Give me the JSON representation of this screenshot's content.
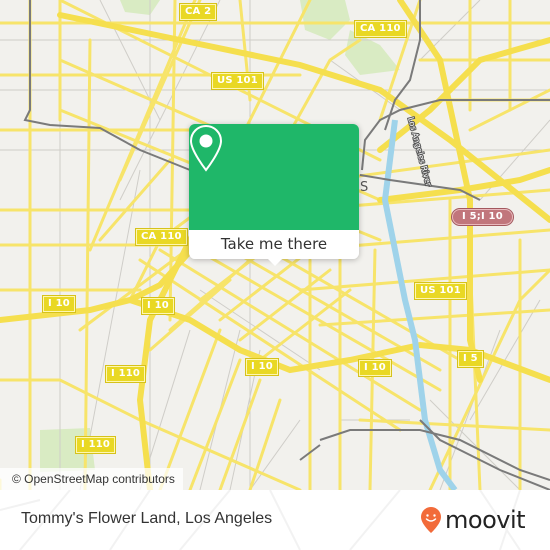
{
  "map": {
    "attribution": "© OpenStreetMap contributors",
    "colors": {
      "background": "#f2f1ed",
      "road": "#f7e46a",
      "road_edge": "#e2cc45",
      "water": "#9fd3ea",
      "rail": "#7a7a7a",
      "park": "#d9ebc3",
      "minor_road": "#c9c7c2"
    },
    "shields": [
      {
        "label": "CA 2",
        "type": "state"
      },
      {
        "label": "CA 110",
        "type": "state"
      },
      {
        "label": "US 101",
        "type": "us"
      },
      {
        "label": "I 5;I 10",
        "type": "interstate-combo"
      },
      {
        "label": "CA 110",
        "type": "state"
      },
      {
        "label": "I 10",
        "type": "interstate"
      },
      {
        "label": "I 10",
        "type": "interstate"
      },
      {
        "label": "US 101",
        "type": "us"
      },
      {
        "label": "I 10",
        "type": "interstate"
      },
      {
        "label": "I 10",
        "type": "interstate"
      },
      {
        "label": "I 5",
        "type": "interstate"
      },
      {
        "label": "I 110",
        "type": "interstate"
      },
      {
        "label": "I 110",
        "type": "interstate"
      }
    ],
    "river_label": "Los Angeles River",
    "partial_label": "S"
  },
  "popup": {
    "icon": "map-pin-icon",
    "button_label": "Take me there",
    "color": "#1fb769"
  },
  "footer": {
    "place_name": "Tommy's Flower Land, Los Angeles",
    "brand": "moovit",
    "brand_color": "#f26b3a"
  }
}
